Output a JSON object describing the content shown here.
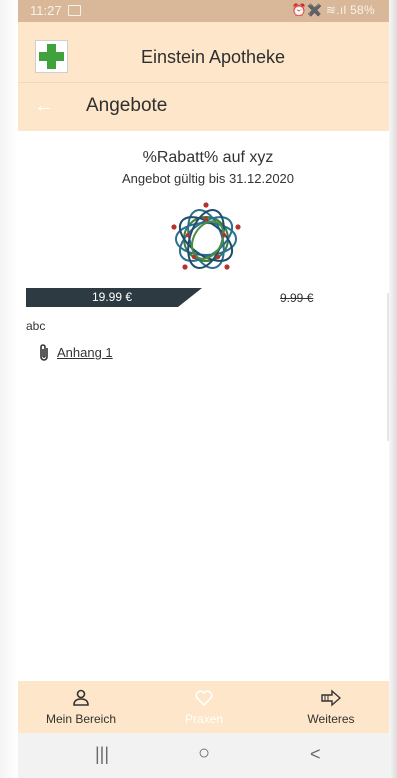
{
  "status_bar": {
    "time": "11:27",
    "right_indicators": "⏰✖️ ≋.ıl 58%",
    "battery": "58%"
  },
  "app": {
    "title": "Einstein Apotheke",
    "logo_icon": "green-cross-icon",
    "brand_color": "#fde6c9",
    "accent_color": "#3fa23a"
  },
  "page": {
    "title": "Angebote",
    "back_icon": "arrow-left-icon"
  },
  "offer": {
    "title": "%Rabatt% auf xyz",
    "valid_until": "Angebot gültig bis 31.12.2020",
    "price_new": "19.99 €",
    "price_old": "9.99 €",
    "description": "abc",
    "attachment_label": "Anhang 1",
    "price_bar_color": "#2e3a42"
  },
  "bottom_nav": {
    "items": [
      {
        "label": "Mein Bereich",
        "icon": "person-icon",
        "active": true
      },
      {
        "label": "Praxen",
        "icon": "heart-icon",
        "active": false
      },
      {
        "label": "Weiteres",
        "icon": "arrow-right-icon",
        "active": true
      }
    ]
  },
  "system_nav": {
    "recent": "|||",
    "home": "○",
    "back": "<"
  }
}
